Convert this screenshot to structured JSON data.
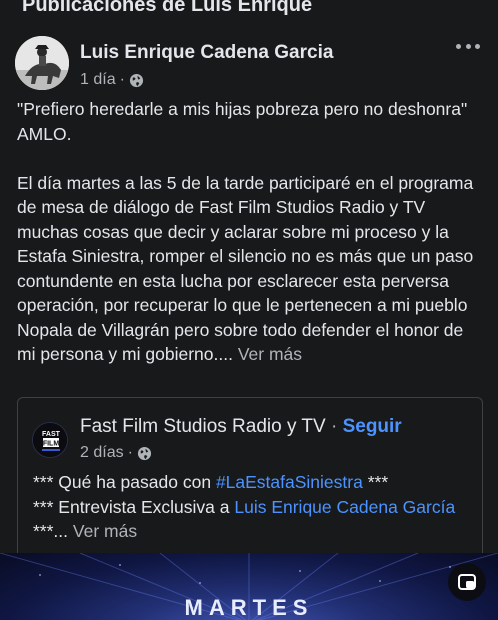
{
  "section": {
    "title": "Publicaciones de Luis Enrique"
  },
  "post": {
    "author": "Luis Enrique Cadena Garcia",
    "time": "1 día",
    "meta_separator": "·",
    "quote": "\"Prefiero heredarle a mis hijas pobreza pero no deshonra\" AMLO.",
    "body": "El día martes a las 5 de la tarde participaré en el programa de mesa de diálogo de Fast Film Studios Radio y TV  muchas cosas que decir y aclarar sobre mi proceso y la Estafa Siniestra, romper el silencio no es más que un paso contundente en esta lucha por esclarecer esta perversa operación, por recuperar lo que le pertenecen a mi pueblo Nopala de Villagrán pero sobre todo defender el honor de mi persona y mi gobierno....",
    "see_more": "Ver más"
  },
  "shared": {
    "page_name": "Fast Film Studios Radio y TV",
    "separator": "·",
    "follow": "Seguir",
    "time": "2 días",
    "meta_separator": "·",
    "line1_prefix": "*** Qué ha pasado con",
    "hashtag": "#LaEstafaSiniestra",
    "line1_suffix": "***",
    "line2_prefix": "*** Entrevista Exclusiva a",
    "mention": "Luis Enrique Cadena García",
    "line2_suffix": "***...",
    "see_more": "Ver más"
  },
  "media": {
    "title": "MARTES"
  },
  "icons": {
    "privacy": "globe-icon",
    "menu": "more-options-icon",
    "pip": "picture-in-picture-icon"
  },
  "colors": {
    "background": "#18191a",
    "text": "#e4e6eb",
    "secondary_text": "#b0b3b8",
    "link": "#4c93ff"
  }
}
